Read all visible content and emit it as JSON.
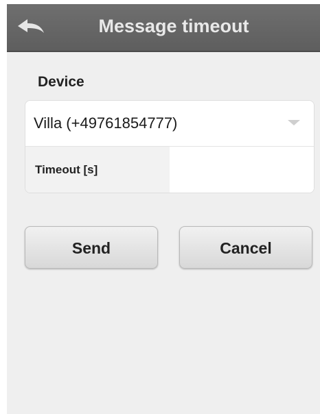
{
  "header": {
    "title": "Message timeout",
    "back_icon": "back-arrow-icon"
  },
  "form": {
    "section_label": "Device",
    "device_value": "Villa (+49761854777)",
    "timeout_label": "Timeout [s]",
    "timeout_value": ""
  },
  "actions": {
    "send_label": "Send",
    "cancel_label": "Cancel"
  }
}
